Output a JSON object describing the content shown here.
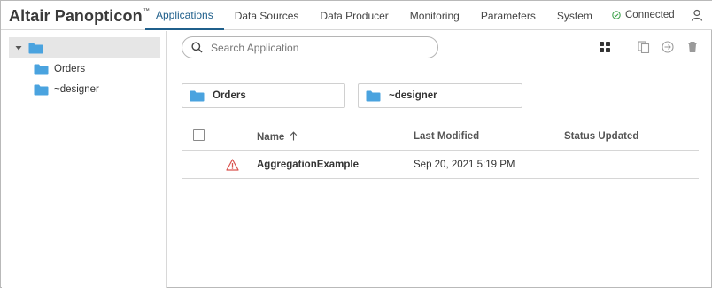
{
  "app": {
    "brand": "Altair Panopticon",
    "brand_tm": "™"
  },
  "nav": {
    "tabs": [
      {
        "label": "Applications",
        "active": true
      },
      {
        "label": "Data Sources",
        "active": false
      },
      {
        "label": "Data Producer",
        "active": false
      },
      {
        "label": "Monitoring",
        "active": false
      },
      {
        "label": "Parameters",
        "active": false
      },
      {
        "label": "System",
        "active": false
      }
    ],
    "status": {
      "label": "Connected",
      "icon": "check-circle-icon",
      "color": "#3fa34d"
    },
    "user_icon": "user-icon"
  },
  "tree": {
    "root": {
      "label": "",
      "icon": "folder-icon",
      "expanded": true
    },
    "children": [
      {
        "label": "Orders",
        "icon": "folder-icon"
      },
      {
        "label": "~designer",
        "icon": "folder-icon"
      }
    ]
  },
  "main": {
    "search": {
      "placeholder": "Search Application",
      "value": ""
    },
    "toolbar": [
      {
        "name": "grid-view-icon"
      },
      {
        "name": "copy-icon"
      },
      {
        "name": "move-icon"
      },
      {
        "name": "delete-icon"
      }
    ],
    "folders": [
      {
        "label": "Orders"
      },
      {
        "label": "~designer"
      }
    ],
    "table": {
      "columns": [
        "Name",
        "Last Modified",
        "Status Updated"
      ],
      "sort": {
        "column": "Name",
        "direction": "ascending"
      },
      "rows": [
        {
          "status_icon": "warning-icon",
          "name": "AggregationExample",
          "last_modified": "Sep 20, 2021 5:19 PM",
          "status_updated": ""
        }
      ]
    }
  },
  "colors": {
    "accent": "#1f5f8b",
    "folder": "#4aa3df",
    "warning": "#d9534f",
    "connected": "#3fa34d"
  }
}
